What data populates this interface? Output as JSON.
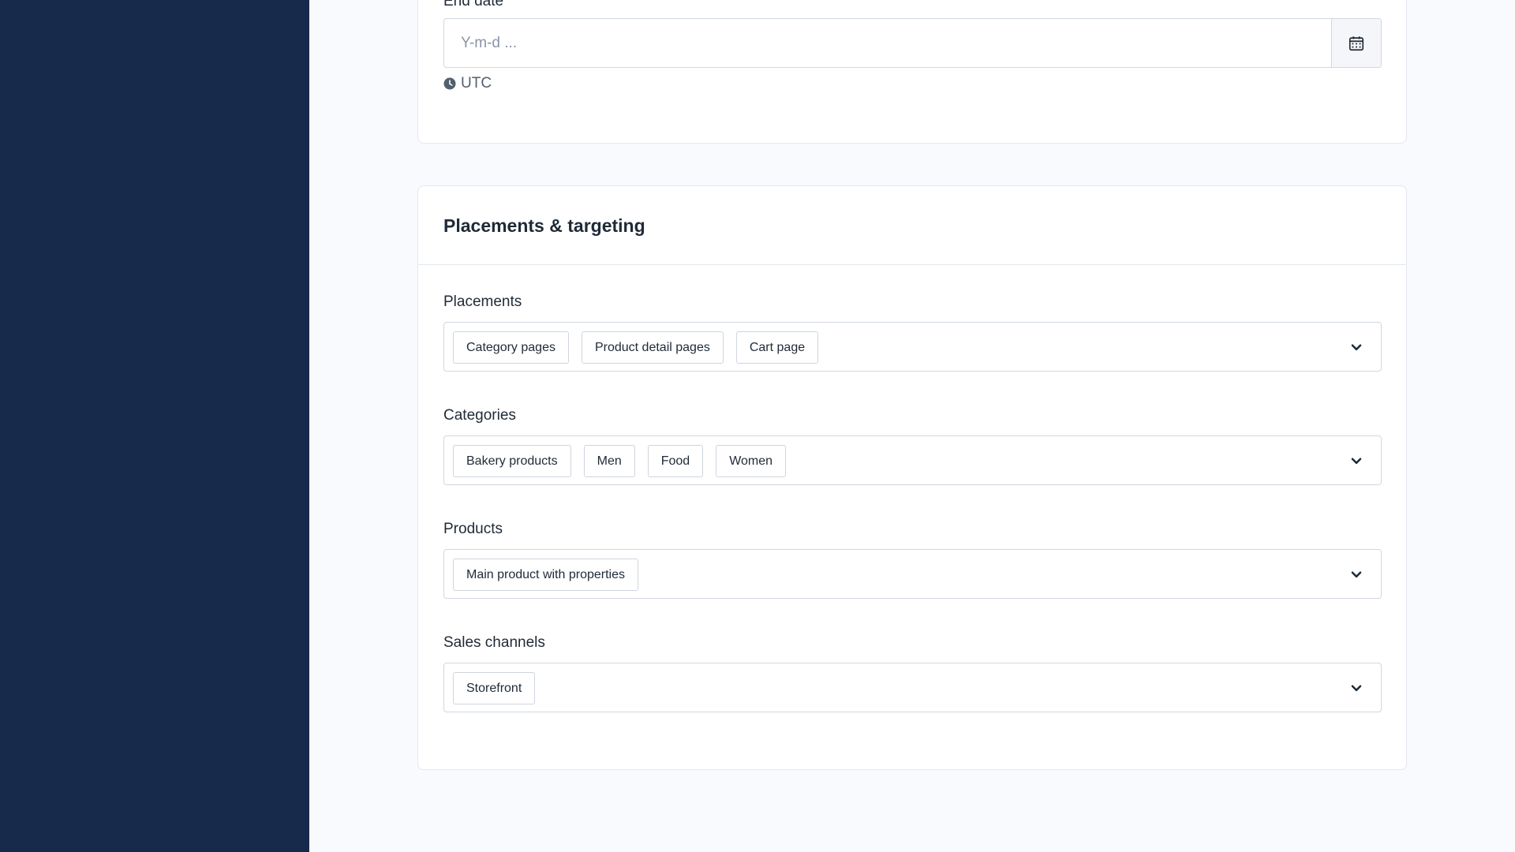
{
  "end_date": {
    "label": "End date",
    "placeholder": "Y-m-d ...",
    "timezone": "UTC"
  },
  "placements_section": {
    "title": "Placements & targeting",
    "placements": {
      "label": "Placements",
      "chips": [
        "Category pages",
        "Product detail pages",
        "Cart page"
      ]
    },
    "categories": {
      "label": "Categories",
      "chips": [
        "Bakery products",
        "Men",
        "Food",
        "Women"
      ]
    },
    "products": {
      "label": "Products",
      "chips": [
        "Main product with properties"
      ]
    },
    "sales_channels": {
      "label": "Sales channels",
      "chips": [
        "Storefront"
      ]
    }
  },
  "colors": {
    "sidebar": "#182a4c",
    "background": "#f9fafd",
    "border": "#d1d7e0"
  }
}
